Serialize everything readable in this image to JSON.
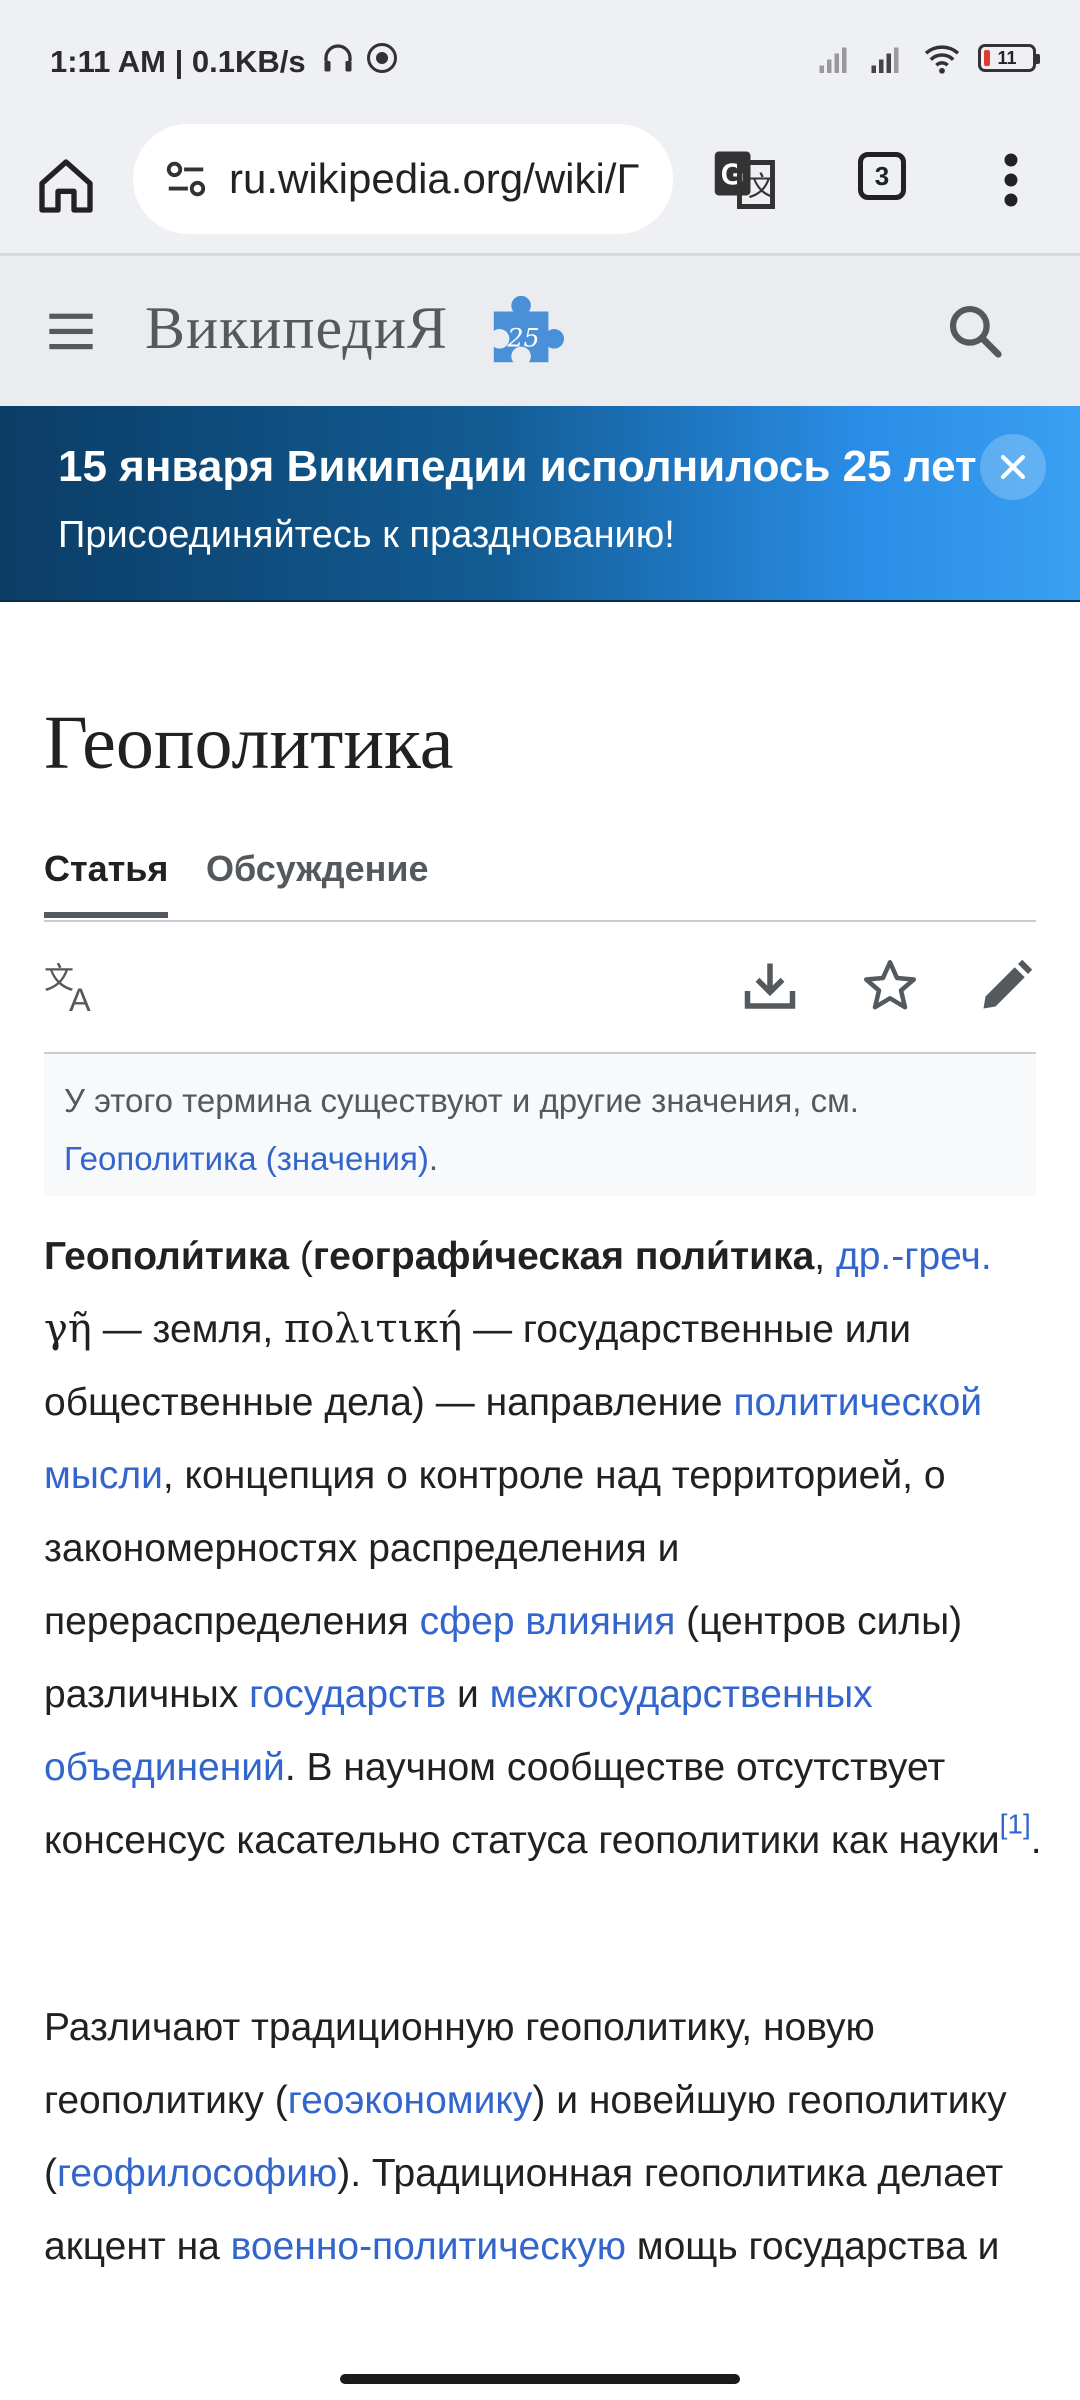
{
  "status": {
    "time": "1:11 AM | 0.1KB/s",
    "battery": "11"
  },
  "browser": {
    "url": "ru.wikipedia.org/wiki/Г",
    "tab_count": "3"
  },
  "wiki": {
    "logo_text": "ВикипедиЯ",
    "anniversary_badge": "25"
  },
  "banner": {
    "title": "15 января Википедии исполнилось 25 лет",
    "subtitle": "Присоединяйтесь к празднованию!"
  },
  "article": {
    "title": "Геополитика",
    "tabs": [
      {
        "label": "Статья"
      },
      {
        "label": "Обсуждение"
      }
    ],
    "hatnote": {
      "text": "У этого термина существуют и другие значения, см.",
      "link": "Геополитика (значения)",
      "tail": "."
    },
    "p1": {
      "term": "Геополи́тика",
      "open": " (",
      "alt_term": "географи́ческая поли́тика",
      "comma": ", ",
      "lang_link": "др.-греч.",
      "greek1": " γῆ",
      "t1": " — земля, ",
      "greek2": "πολιτική",
      "t2": " — государственные или общественные дела) — направление ",
      "link1": "политической мысли",
      "t3": ", концепция о контроле над территорией, о закономерностях распределения и перераспределения ",
      "link2": "сфер влияния",
      "t4": " (центров силы) различных ",
      "link3": "государств",
      "t5": " и ",
      "link4": "межгосударственных объединений",
      "t6": ". В научном сообществе отсутствует консенсус касательно статуса геополитики как науки",
      "ref": "[1]",
      "end": "."
    },
    "p2": {
      "t1": "Различают традиционную геополитику, новую геополитику (",
      "link1": "геоэкономику",
      "t2": ") и новейшую геополитику (",
      "link2": "геофилософию",
      "t3": "). Традиционная геополитика делает акцент на ",
      "link3": "военно-политическую",
      "t4": " мощь государства и"
    }
  }
}
